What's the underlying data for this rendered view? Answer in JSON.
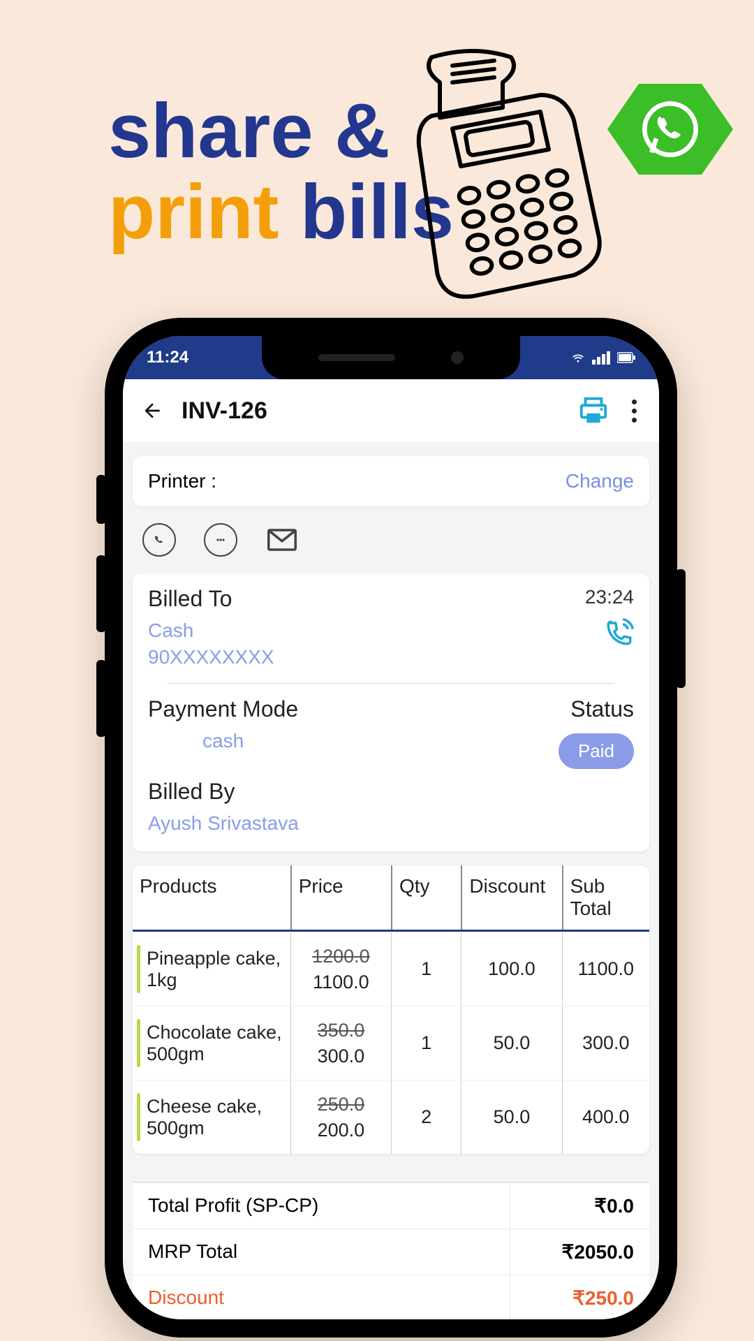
{
  "marketing": {
    "line1a": "share",
    "line1b": "&",
    "line2a": "print",
    "line2b": "bills"
  },
  "statusbar": {
    "time": "11:24"
  },
  "appbar": {
    "title": "INV-126"
  },
  "printer": {
    "label": "Printer :",
    "change": "Change"
  },
  "bill": {
    "billed_to_label": "Billed To",
    "customer_name": "Cash",
    "customer_phone": "90XXXXXXXX",
    "time": "23:24",
    "payment_mode_label": "Payment Mode",
    "payment_mode_value": "cash",
    "status_label": "Status",
    "status_value": "Paid",
    "billed_by_label": "Billed By",
    "billed_by_value": "Ayush Srivastava"
  },
  "table": {
    "headers": {
      "product": "Products",
      "price": "Price",
      "qty": "Qty",
      "discount": "Discount",
      "subtotal": "Sub Total"
    },
    "rows": [
      {
        "product": "Pineapple cake, 1kg",
        "price_orig": "1200.0",
        "price": "1100.0",
        "qty": "1",
        "discount": "100.0",
        "subtotal": "1100.0"
      },
      {
        "product": "Chocolate cake, 500gm",
        "price_orig": "350.0",
        "price": "300.0",
        "qty": "1",
        "discount": "50.0",
        "subtotal": "300.0"
      },
      {
        "product": "Cheese cake, 500gm",
        "price_orig": "250.0",
        "price": "200.0",
        "qty": "2",
        "discount": "50.0",
        "subtotal": "400.0"
      }
    ]
  },
  "totals": {
    "profit_label": "Total Profit (SP-CP)",
    "profit_value": "₹0.0",
    "mrp_label": "MRP Total",
    "mrp_value": "₹2050.0",
    "discount_label": "Discount",
    "discount_value": "₹250.0"
  }
}
